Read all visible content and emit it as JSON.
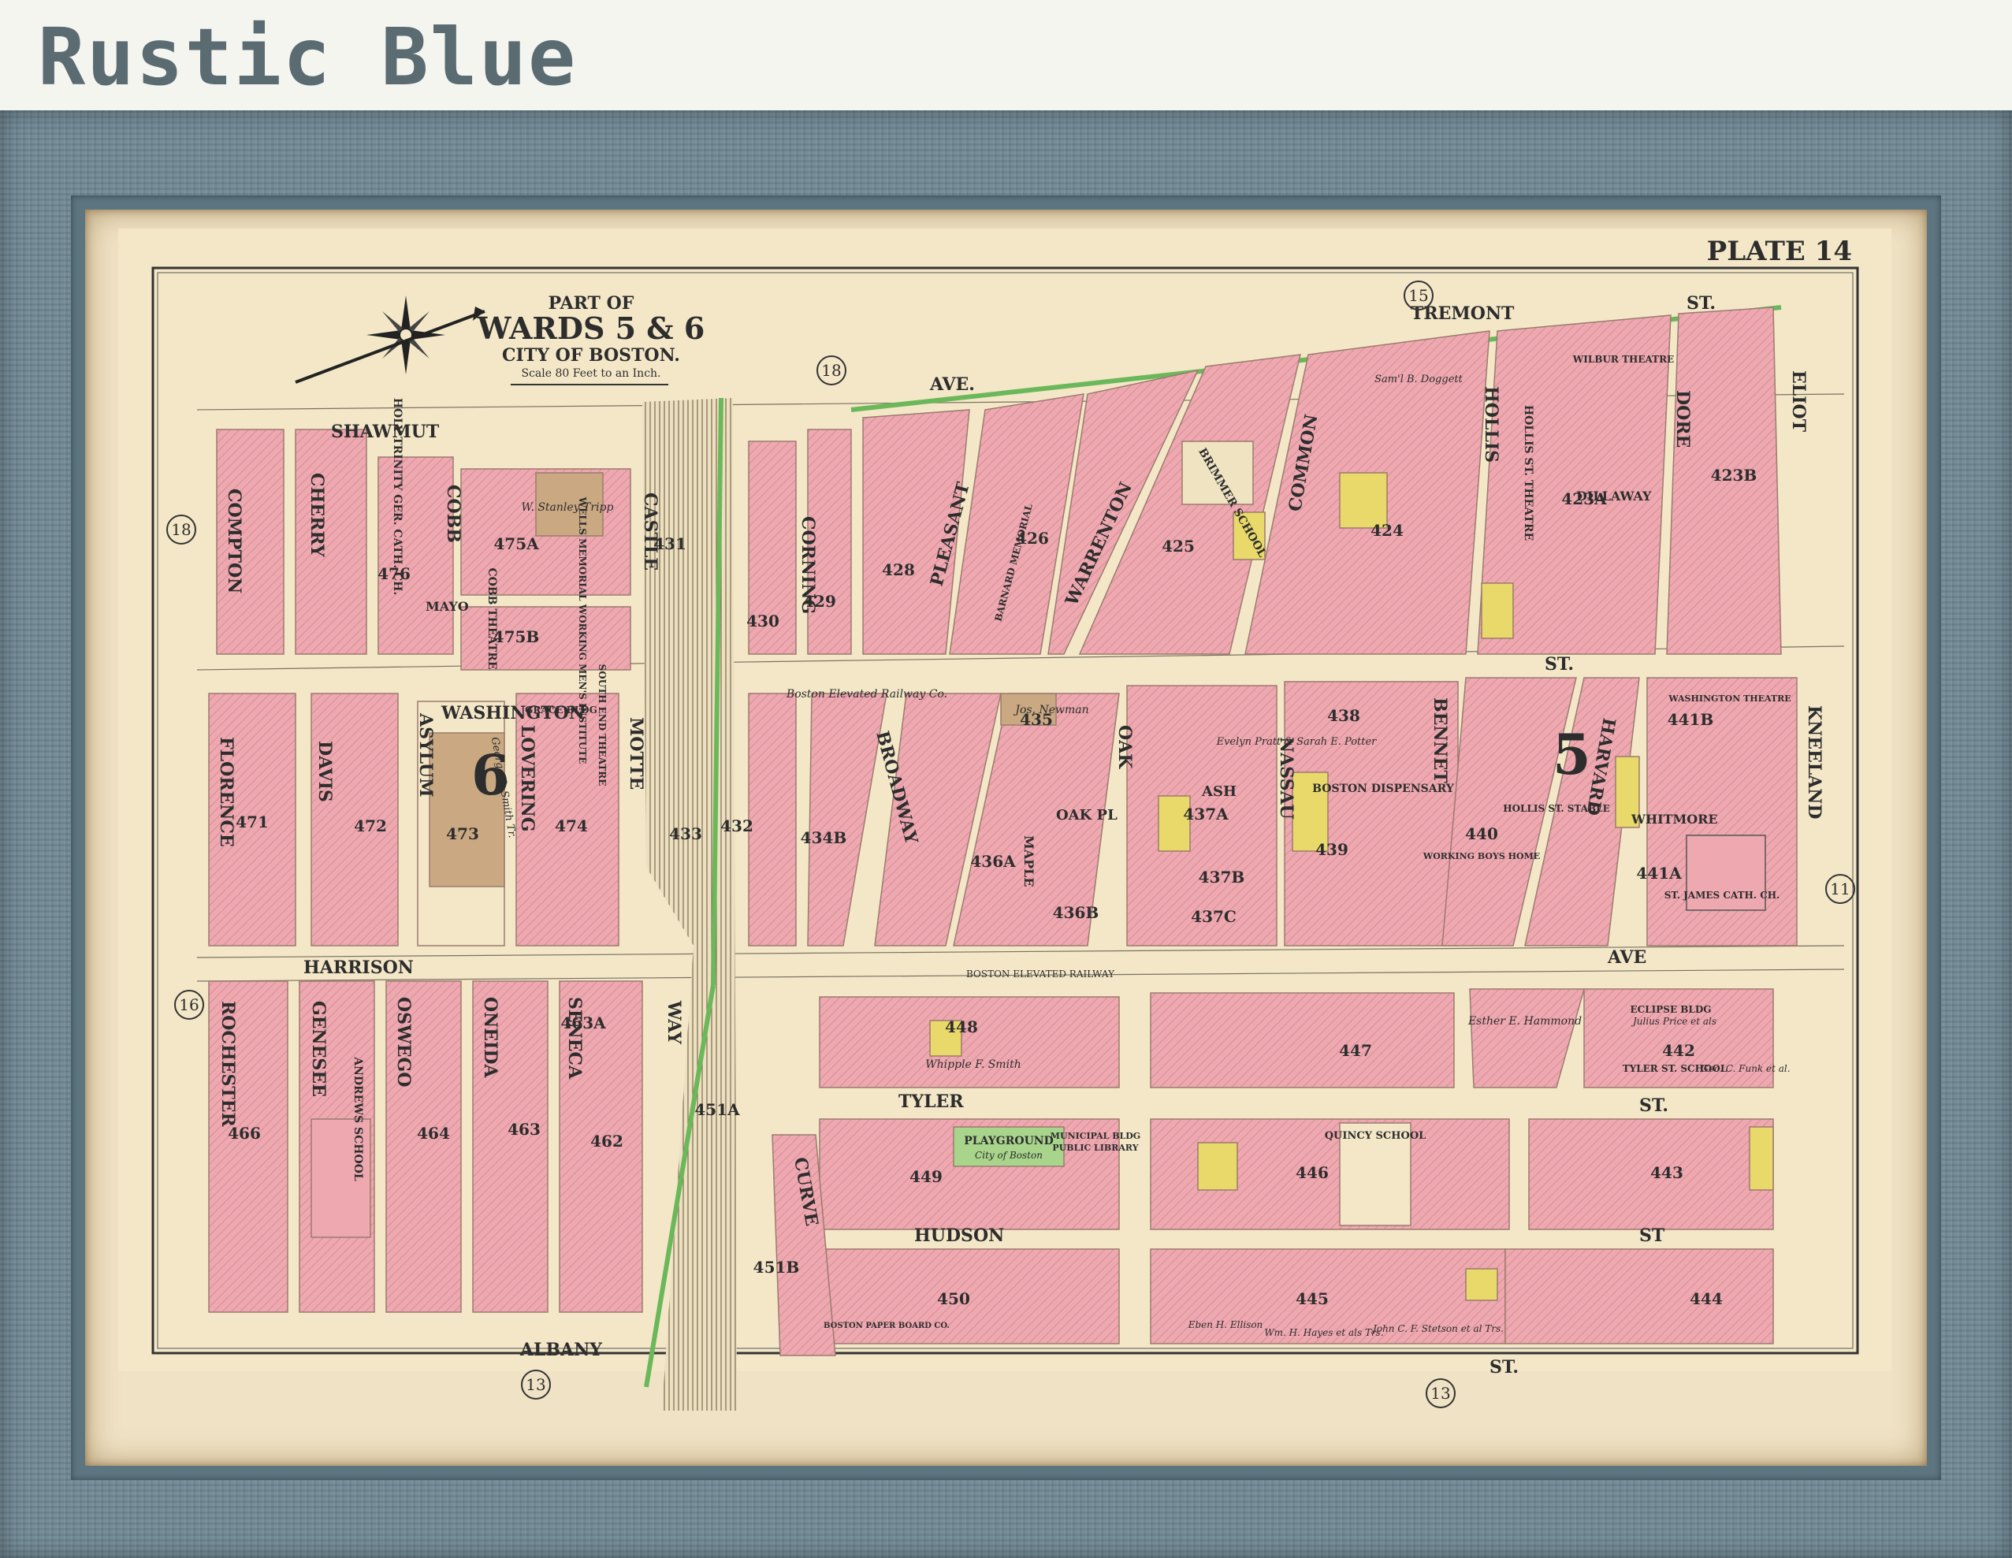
{
  "header": {
    "title": "Rustic Blue"
  },
  "map": {
    "plate": "PLATE 14",
    "title": {
      "line1": "PART OF",
      "line2": "WARDS 5 & 6",
      "line3": "CITY OF BOSTON.",
      "scale": "Scale 80 Feet to an Inch."
    },
    "wards": {
      "w6": "6",
      "w5": "5"
    },
    "adjacent_plates": {
      "p15": "15",
      "p18a": "18",
      "p18b": "18",
      "p16": "16",
      "p11": "11",
      "p13a": "13",
      "p13b": "13"
    },
    "streets": {
      "tremont": "TREMONT",
      "tremont_st": "ST.",
      "ave": "AVE.",
      "shawmut": "SHAWMUT",
      "washington": "WASHINGTON",
      "harrison": "HARRISON",
      "harrison_ave": "AVE",
      "tyler": "TYLER",
      "tyler_st": "ST.",
      "hudson": "HUDSON",
      "hudson_st": "ST",
      "albany": "ALBANY",
      "albany_st": "ST.",
      "washington_st": "ST.",
      "compton": "COMPTON",
      "cherry": "CHERRY",
      "cobb": "COBB",
      "castle": "CASTLE",
      "corning": "CORNING",
      "pleasant": "PLEASANT",
      "warrenton": "WARRENTON",
      "common": "COMMON",
      "hollis": "HOLLIS",
      "dore": "DORE",
      "eliot": "ELIOT",
      "mayo": "MAYO",
      "dillaway": "DILLAWAY",
      "florence": "FLORENCE",
      "davis": "DAVIS",
      "asylum": "ASYLUM",
      "lovering": "LOVERING",
      "motte": "MOTTE",
      "broadway": "BROADWAY",
      "oak_pl": "OAK PL",
      "oak": "OAK",
      "ash": "ASH",
      "nassau": "NASSAU",
      "bennet": "BENNET",
      "harvard": "HARVARD",
      "kneeland": "KNEELAND",
      "whitmore": "WHITMORE",
      "maple": "MAPLE",
      "rochester": "ROCHESTER",
      "genesee": "GENESEE",
      "oswego": "OSWEGO",
      "oneida": "ONEIDA",
      "seneca": "SENECA",
      "way": "WAY",
      "curve": "CURVE",
      "st": "ST."
    },
    "block_numbers": [
      "475A",
      "475B",
      "476",
      "431",
      "430",
      "429",
      "428",
      "426",
      "425",
      "424",
      "423A",
      "423B",
      "471",
      "472",
      "473",
      "474",
      "433",
      "432",
      "434B",
      "435",
      "436A",
      "437A",
      "437B",
      "437C",
      "436B",
      "438",
      "439",
      "440",
      "441A",
      "441B",
      "448",
      "447",
      "442",
      "451A",
      "451B",
      "449",
      "446",
      "443",
      "450",
      "445",
      "444",
      "466",
      "464",
      "463",
      "462",
      "463A"
    ],
    "landmarks": {
      "holy_trinity": "HOLY TRINITY GER. CATH. CH.",
      "cobb_theatre": "COBB THEATRE",
      "wells_school": "WELLS MEMORIAL WORKING MEN'S INSTITUTE",
      "brimmer_school": "BRIMMER SCHOOL",
      "barnard_memorial": "BARNARD MEMORIAL",
      "hollis_theatre": "HOLLIS ST. THEATRE",
      "wilbur_theatre": "WILBUR THEATRE",
      "grace_bldg": "GRACE BLDG",
      "south_end_theatre": "SOUTH END THEATRE",
      "boston_elevated": "Boston Elevated Railway Co.",
      "boston_dispensary": "BOSTON DISPENSARY",
      "hollis_st_stable": "HOLLIS ST. STABLE",
      "working_boys_home": "WORKING BOYS HOME",
      "washington_theatre": "WASHINGTON THEATRE",
      "st_james": "ST. JAMES CATH. CH.",
      "eclipse_bldg": "ECLIPSE BLDG",
      "tyler_st_school": "TYLER ST. SCHOOL",
      "playground": "PLAYGROUND",
      "playground_owner": "City of Boston",
      "municipal_bldg": "MUNICIPAL BLDG",
      "public_library": "PUBLIC LIBRARY",
      "quincy_school": "QUINCY SCHOOL",
      "andrews_school": "ANDREWS SCHOOL",
      "paper_board": "BOSTON PAPER BOARD CO.",
      "elevated_railway": "BOSTON ELEVATED RAILWAY"
    },
    "owners": {
      "tripp": "W. Stanley Tripp",
      "newman": "Jos. Newman",
      "pratt": "Evelyn Pratt & Sarah E. Potter",
      "doggett": "Sam'l B. Doggett",
      "whipple": "Whipple F. Smith",
      "hammond": "Esther E. Hammond",
      "price": "Julius Price et als",
      "funk": "Geo. C. Funk et al.",
      "smith": "George S. Smith Tr.",
      "ellison": "Eben H. Ellison",
      "hayes": "Wm. H. Hayes et als Trs.",
      "stetson": "John C. F. Stetson et al Trs."
    }
  },
  "colors": {
    "frame": "#6f8894",
    "mat": "#f0e2c4",
    "paper": "#f3e7c8",
    "building_brick": "#eda8b0",
    "building_wood": "#e8d96a",
    "park": "#a8d48c",
    "ink": "#2d2d2d",
    "title_text": "#5b6b72"
  }
}
